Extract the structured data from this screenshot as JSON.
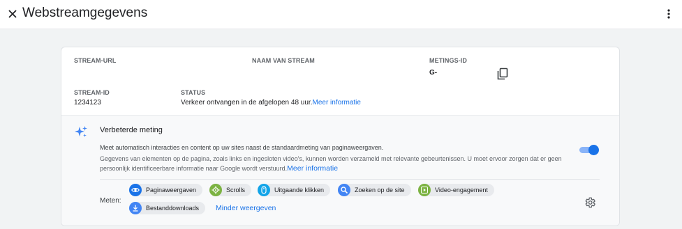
{
  "header": {
    "title": "Webstreamgegevens",
    "close_icon": "close-icon",
    "more_icon": "more-vert-icon"
  },
  "details": {
    "stream_url_label": "STREAM-URL",
    "stream_name_label": "NAAM VAN STREAM",
    "measurement_id_label": "METINGS-ID",
    "measurement_id_value": "G-",
    "stream_id_label": "STREAM-ID",
    "stream_id_value": "1234123",
    "status_label": "STATUS",
    "status_text": "Verkeer ontvangen in de afgelopen 48 uur.",
    "status_link": "Meer informatie"
  },
  "enhanced": {
    "title": "Verbeterde meting",
    "description_main": "Meet automatisch interacties en content op uw sites naast de standaardmeting van paginaweergaven.",
    "description_detail": "Gegevens van elementen op de pagina, zoals links en ingesloten video's, kunnen worden verzameld met relevante gebeurtenissen. U moet ervoor zorgen dat er geen persoonlijk identificeerbare informatie naar Google wordt verstuurd.",
    "description_link": "Meer informatie",
    "toggle_on": true,
    "measure_label": "Meten:",
    "chips": [
      {
        "label": "Paginaweergaven",
        "icon": "eye-icon",
        "color": "#1a73e8"
      },
      {
        "label": "Scrolls",
        "icon": "scroll-target-icon",
        "color": "#7cb342"
      },
      {
        "label": "Uitgaande klikken",
        "icon": "mouse-icon",
        "color": "#12a4e8"
      },
      {
        "label": "Zoeken op de site",
        "icon": "search-icon",
        "color": "#4285f4"
      },
      {
        "label": "Video-engagement",
        "icon": "play-icon",
        "color": "#7cb342"
      },
      {
        "label": "Bestanddownloads",
        "icon": "download-icon",
        "color": "#4285f4"
      }
    ],
    "show_less_link": "Minder weergeven"
  },
  "colors": {
    "accent": "#1a73e8",
    "background": "#f1f3f4"
  }
}
